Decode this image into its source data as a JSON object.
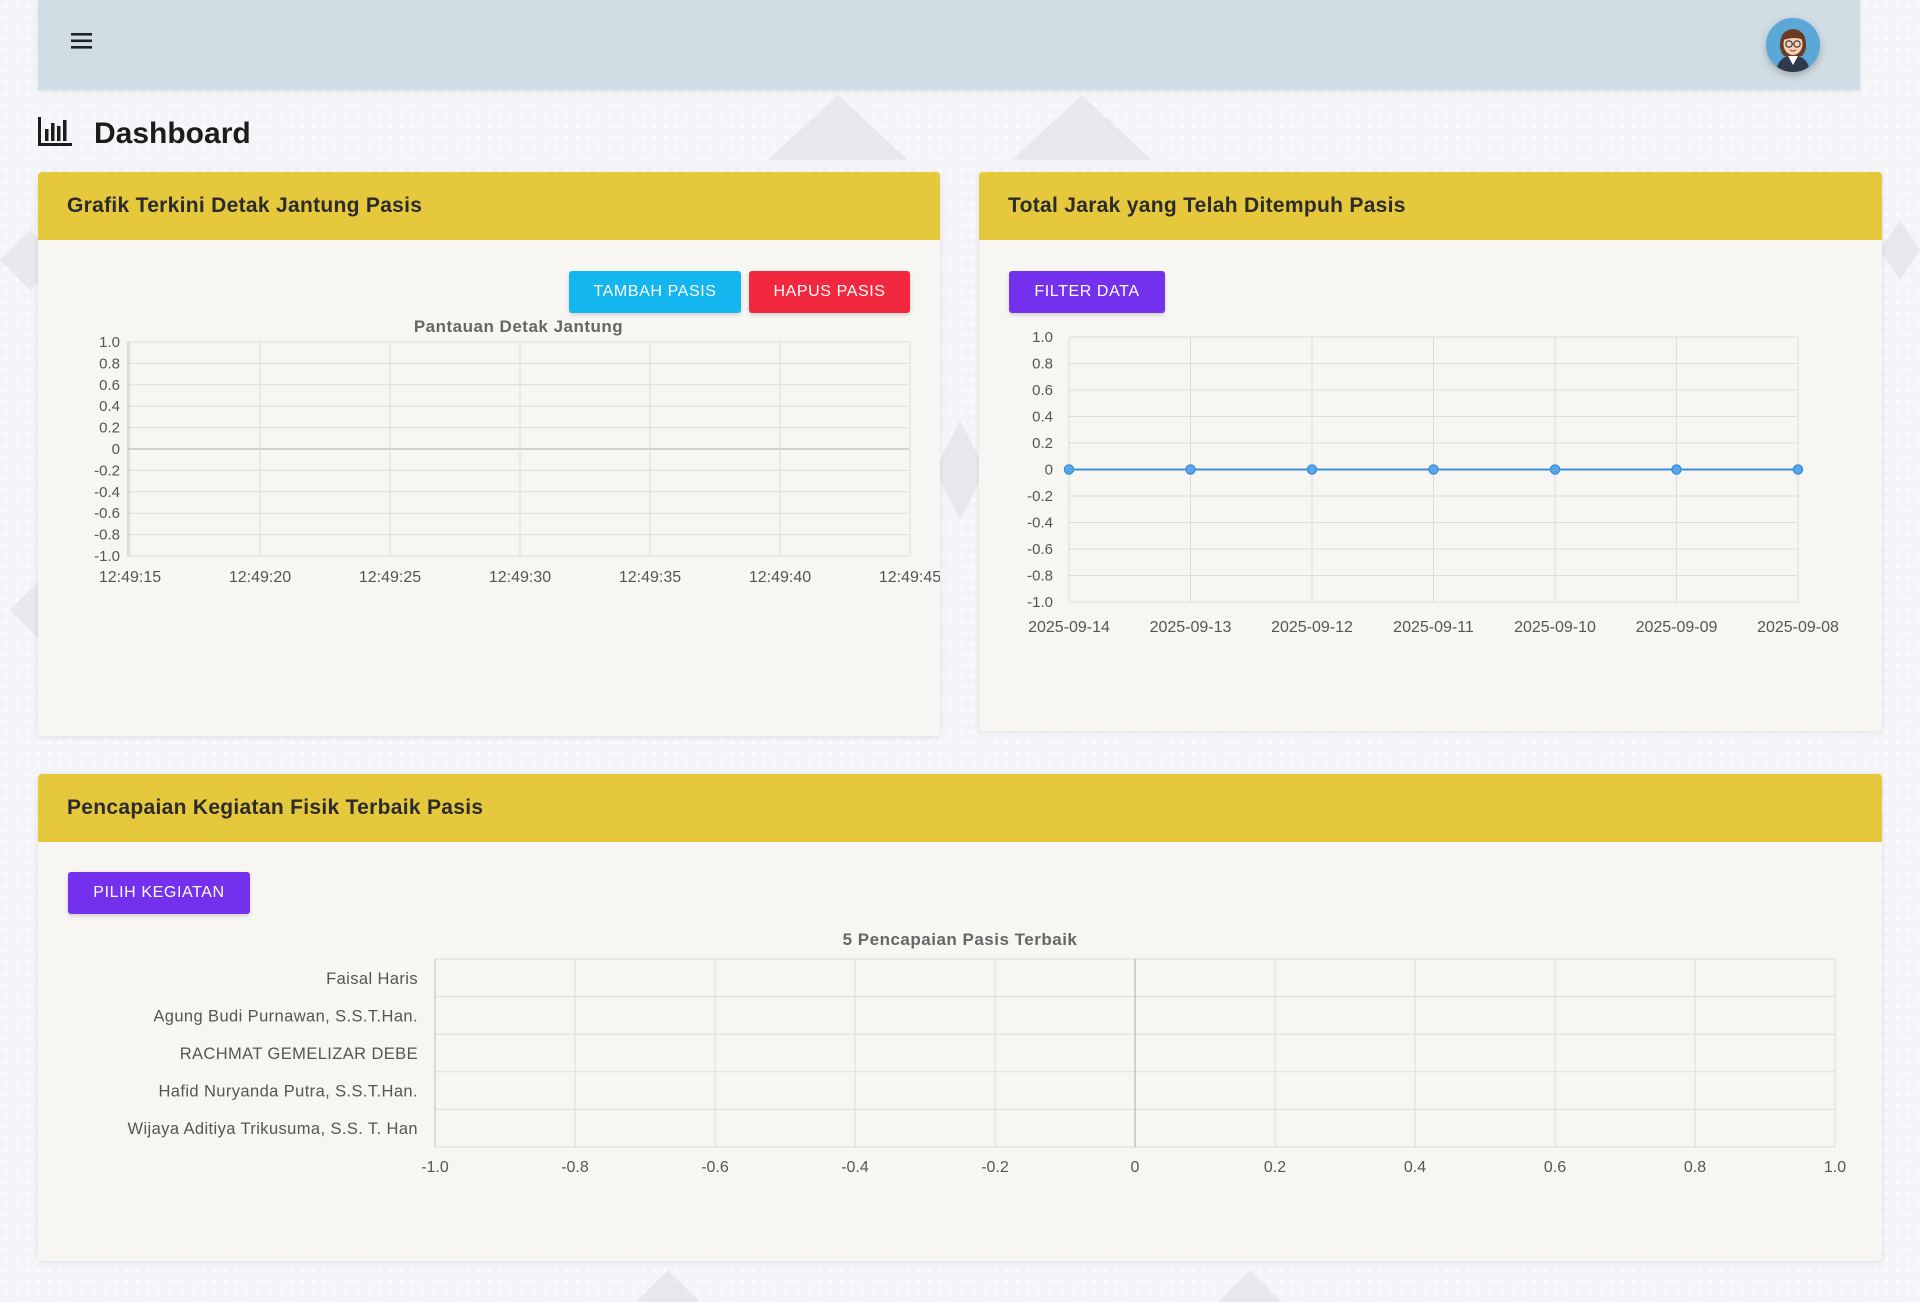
{
  "header": {
    "menu_icon": "hamburger-menu-icon",
    "avatar_icon": "user-avatar-icon"
  },
  "page": {
    "title": "Dashboard",
    "title_icon": "bar-chart-icon"
  },
  "colors": {
    "header_bg": "#d1dde5",
    "card_header": "#e6c83d",
    "btn_blue": "#14b6ef",
    "btn_red": "#f1283e",
    "btn_purple": "#7431ed",
    "line_series": "#3d8fd8"
  },
  "heart_card": {
    "title": "Grafik Terkini Detak Jantung Pasis",
    "add_label": "TAMBAH PASIS",
    "delete_label": "HAPUS PASIS"
  },
  "distance_card": {
    "title": "Total Jarak yang Telah Ditempuh Pasis",
    "filter_label": "FILTER DATA"
  },
  "activity_card": {
    "title": "Pencapaian Kegiatan Fisik Terbaik Pasis",
    "select_label": "PILIH KEGIATAN"
  },
  "chart_data": [
    {
      "type": "line",
      "title": "Pantauan Detak Jantung",
      "x": [
        "12:49:15",
        "12:49:20",
        "12:49:25",
        "12:49:30",
        "12:49:35",
        "12:49:40",
        "12:49:45"
      ],
      "x_tick_labels": [
        "12:49:15",
        "12:49:20",
        "12:49:25",
        "12:49:30",
        "12:49:35",
        "12:49:40",
        "12:49:45"
      ],
      "y_ticks": [
        "1.0",
        "0.8",
        "0.6",
        "0.4",
        "0.2",
        "0",
        "-0.2",
        "-0.4",
        "-0.6",
        "-0.8",
        "-1.0"
      ],
      "ylim": [
        -1,
        1
      ],
      "series": [],
      "grid": true
    },
    {
      "type": "line",
      "title": "",
      "x": [
        "2025-09-14",
        "2025-09-13",
        "2025-09-12",
        "2025-09-11",
        "2025-09-10",
        "2025-09-09",
        "2025-09-08"
      ],
      "y_ticks": [
        "1.0",
        "0.8",
        "0.6",
        "0.4",
        "0.2",
        "0",
        "-0.2",
        "-0.4",
        "-0.6",
        "-0.8",
        "-1.0"
      ],
      "ylim": [
        -1,
        1
      ],
      "series": [
        {
          "values": [
            0,
            0,
            0,
            0,
            0,
            0,
            0
          ]
        }
      ],
      "grid": true
    },
    {
      "type": "bar",
      "orientation": "horizontal",
      "title": "5 Pencapaian Pasis Terbaik",
      "categories": [
        "Faisal Haris",
        "Agung Budi Purnawan, S.S.T.Han.",
        "RACHMAT GEMELIZAR DEBE",
        "Hafid Nuryanda Putra, S.S.T.Han.",
        "Wijaya Aditiya Trikusuma, S.S. T. Han"
      ],
      "values": [
        0,
        0,
        0,
        0,
        0
      ],
      "x_ticks": [
        "-1.0",
        "-0.8",
        "-0.6",
        "-0.4",
        "-0.2",
        "0",
        "0.2",
        "0.4",
        "0.6",
        "0.8",
        "1.0"
      ],
      "xlim": [
        -1,
        1
      ],
      "grid": true
    }
  ]
}
